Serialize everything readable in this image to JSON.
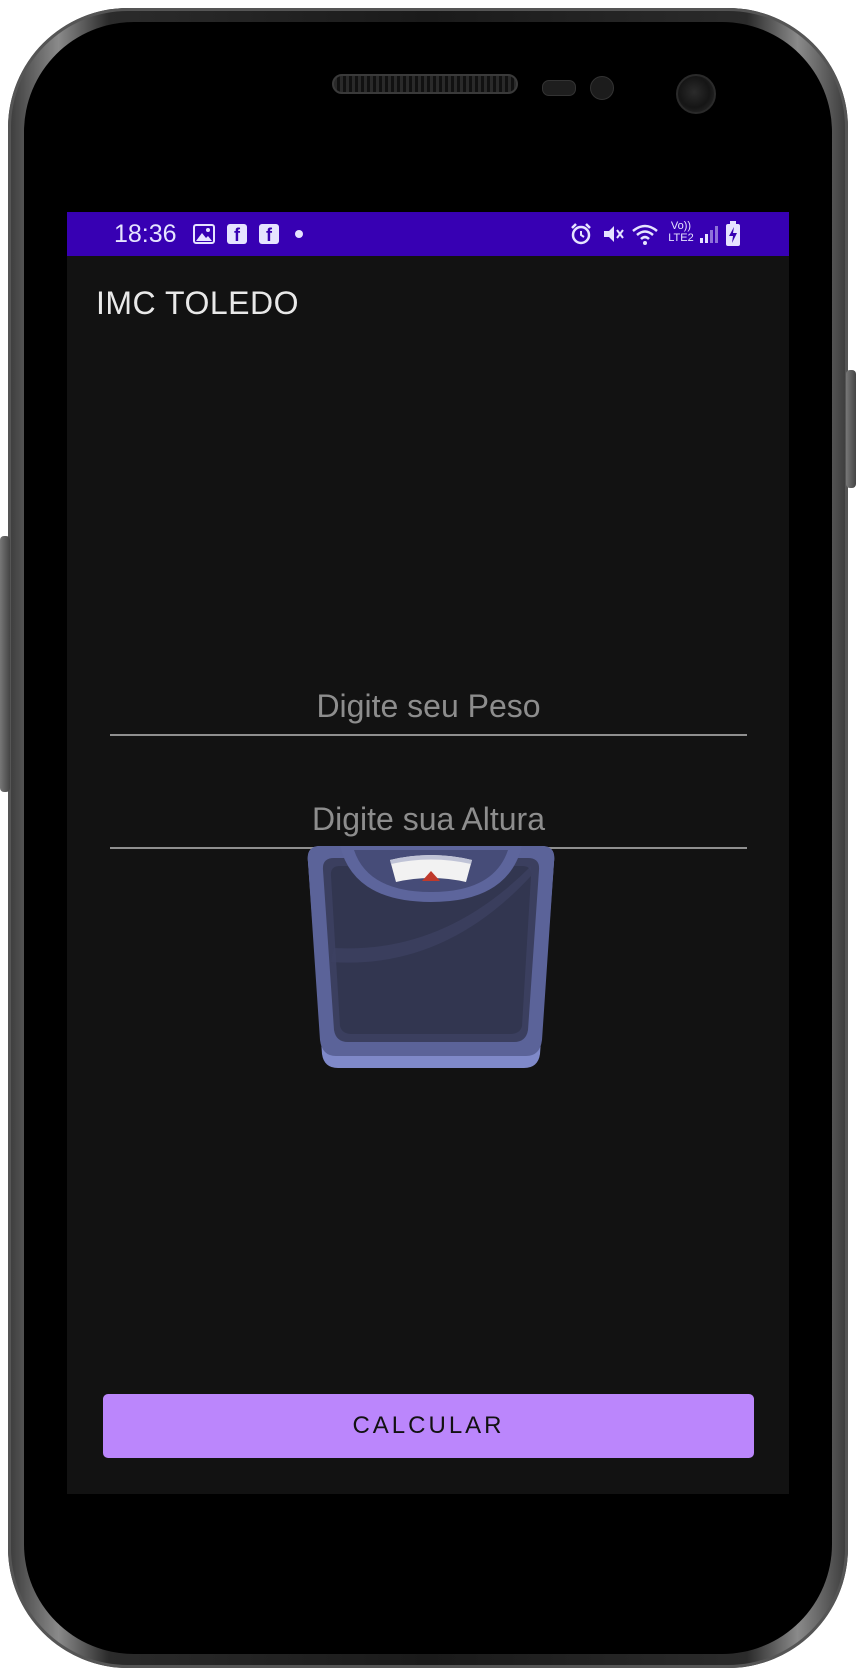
{
  "status_bar": {
    "time": "18:36",
    "background": "#3700b3",
    "left_icons": [
      "image-icon",
      "facebook-icon",
      "facebook-icon",
      "dot-icon"
    ],
    "right_icons": [
      "alarm-icon",
      "mute-icon",
      "wifi-icon",
      "volte-lte2-icon",
      "signal-icon",
      "battery-icon"
    ],
    "volte_text": "Vo)) LTE2"
  },
  "app": {
    "title": "IMC TOLEDO"
  },
  "form": {
    "weight_placeholder": "Digite seu Peso",
    "height_placeholder": "Digite sua Altura"
  },
  "button": {
    "label": "CALCULAR",
    "color": "#bb86fc"
  },
  "image": {
    "icon": "scale-icon"
  },
  "theme": {
    "screen_background": "#121212"
  }
}
